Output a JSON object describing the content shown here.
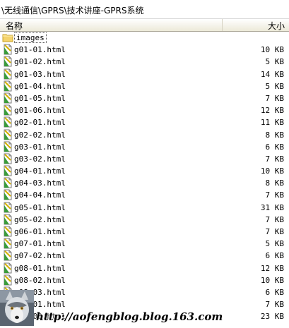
{
  "path": "\\无线通信\\GPRS\\技术讲座-GPRS系统",
  "columns": {
    "name": "名称",
    "size": "大小",
    "sort_arrow": "^"
  },
  "folder": {
    "name": "images"
  },
  "files": [
    {
      "name": "g01-01.html",
      "size": "10 KB"
    },
    {
      "name": "g01-02.html",
      "size": "5 KB"
    },
    {
      "name": "g01-03.html",
      "size": "14 KB"
    },
    {
      "name": "g01-04.html",
      "size": "5 KB"
    },
    {
      "name": "g01-05.html",
      "size": "7 KB"
    },
    {
      "name": "g01-06.html",
      "size": "12 KB"
    },
    {
      "name": "g02-01.html",
      "size": "11 KB"
    },
    {
      "name": "g02-02.html",
      "size": "8 KB"
    },
    {
      "name": "g03-01.html",
      "size": "6 KB"
    },
    {
      "name": "g03-02.html",
      "size": "7 KB"
    },
    {
      "name": "g04-01.html",
      "size": "10 KB"
    },
    {
      "name": "g04-03.html",
      "size": "8 KB"
    },
    {
      "name": "g04-04.html",
      "size": "7 KB"
    },
    {
      "name": "g05-01.html",
      "size": "31 KB"
    },
    {
      "name": "g05-02.html",
      "size": "7 KB"
    },
    {
      "name": "g06-01.html",
      "size": "7 KB"
    },
    {
      "name": "g07-01.html",
      "size": "5 KB"
    },
    {
      "name": "g07-02.html",
      "size": "6 KB"
    },
    {
      "name": "g08-01.html",
      "size": "12 KB"
    },
    {
      "name": "g08-02.html",
      "size": "10 KB"
    },
    {
      "name": "g08-03.html",
      "size": "6 KB"
    },
    {
      "name": "g09-01.html",
      "size": "7 KB"
    },
    {
      "name": "g09-02.html",
      "size": "23 KB"
    }
  ],
  "watermark": "http://aofengblog.blog.163.com"
}
